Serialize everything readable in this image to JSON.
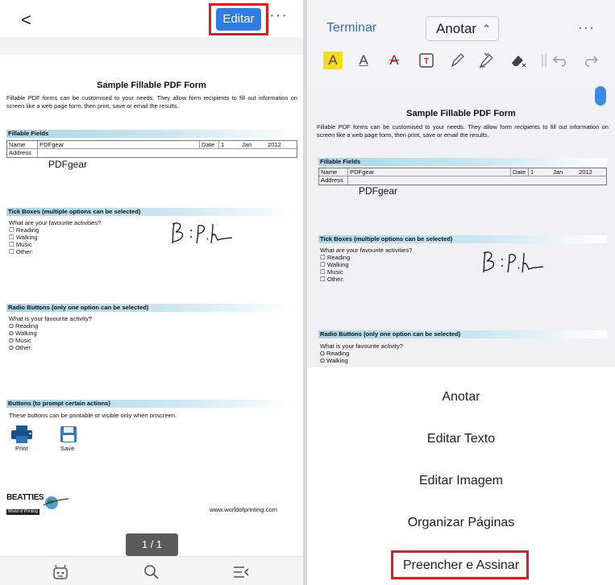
{
  "left": {
    "back_glyph": "<",
    "edit_label": "Editar",
    "more_glyph": "···",
    "page_indicator": "1 / 1",
    "bottom_icons": [
      "robot-assistant-icon",
      "search-icon",
      "list-menu-icon"
    ]
  },
  "right": {
    "done_label": "Terminar",
    "mode_label": "Anotar",
    "more_glyph": "···",
    "tools": [
      "highlight-A-icon",
      "underline-A-icon",
      "strikethrough-A-icon",
      "text-box-icon",
      "pencil-icon",
      "highlighter-pen-icon",
      "eraser-icon",
      "undo-icon",
      "redo-icon"
    ],
    "menu": [
      "Anotar",
      "Editar Texto",
      "Editar Imagem",
      "Organizar Páginas",
      "Preencher e Assinar"
    ]
  },
  "pdf": {
    "title": "Sample Fillable PDF Form",
    "intro": "Fillable PDF forms can be customised to your needs. They allow form recipients to fill out information on screen like a web page form, then print, save or email the results.",
    "fillable_heading": "Fillable Fields",
    "name_label": "Name",
    "name_value": "PDFgear",
    "date_label": "Date",
    "date_day": "1",
    "date_month": "Jan",
    "date_year": "2012",
    "address_label": "Address",
    "typed_text": "PDFgear",
    "tick_heading": "Tick Boxes (multiple options can be selected)",
    "tick_question": "What are your favourite activities?",
    "tick_options": [
      "☐ Reading",
      "☐ Walking",
      "☐ Music",
      "☐ Other:"
    ],
    "radio_heading": "Radio Buttons (only one option can be selected)",
    "radio_question": "What is your favourite activity?",
    "radio_options": [
      "O Reading",
      "O Walking",
      "O Music",
      "O Other:"
    ],
    "buttons_heading": "Buttons (to prompt certain actions)",
    "buttons_note": "These buttons can be printable or visible only when onscreen.",
    "print_label": "Print",
    "save_label": "Save",
    "logo_main": "BEATTIES",
    "logo_sub": "World of Printing",
    "website": "www.worldofprinting.com"
  },
  "colors": {
    "accent": "#2e7de6",
    "link": "#2f6fc1",
    "highlight": "#e01b1b",
    "section": "#a9d5e8"
  }
}
